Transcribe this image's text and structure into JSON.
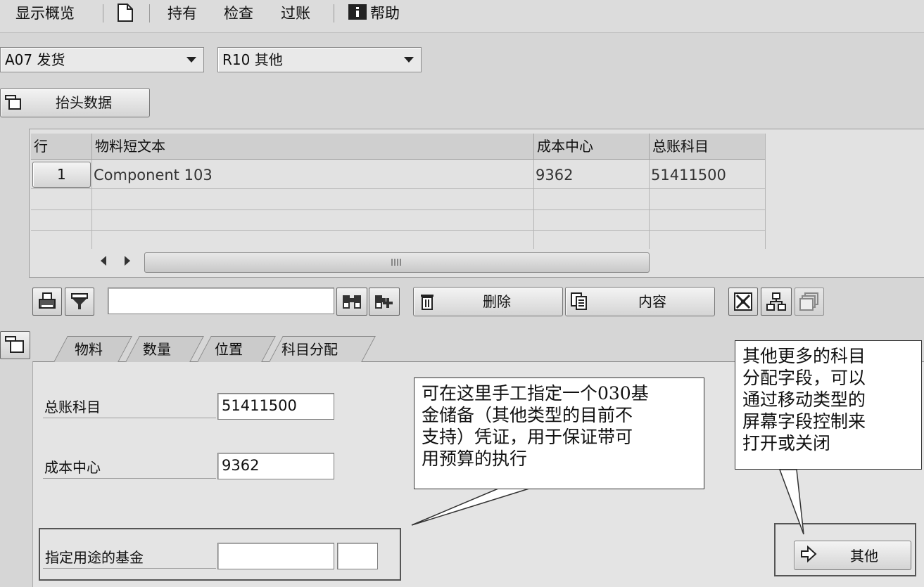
{
  "menubar": {
    "items": [
      "显示概览",
      "持有",
      "检查",
      "过账",
      "帮助"
    ]
  },
  "selectors": {
    "transaction": "A07 发货",
    "movement": "R10 其他"
  },
  "header_button": "抬头数据",
  "table": {
    "columns": [
      "行",
      "物料短文本",
      "成本中心",
      "总账科目"
    ],
    "rows": [
      {
        "line": "1",
        "material_text": "Component 103",
        "cost_center": "9362",
        "gl_account": "51411500"
      }
    ]
  },
  "toolbar": {
    "delete_label": "删除",
    "contents_label": "内容",
    "search_value": ""
  },
  "tabs": [
    "物料",
    "数量",
    "位置",
    "科目分配"
  ],
  "form": {
    "gl_account_label": "总账科目",
    "gl_account_value": "51411500",
    "cost_center_label": "成本中心",
    "cost_center_value": "9362",
    "earmarked_fund_label": "指定用途的基金",
    "earmarked_fund_value": "",
    "earmarked_fund_item": ""
  },
  "other_button": "其他",
  "callouts": {
    "fund_note": "可在这里手工指定一个030基\n金储备（其他类型的目前不\n支持）凭证，用于保证带可\n用预算的执行",
    "more_fields_note": "其他更多的科目\n分配字段，可以\n通过移动类型的\n屏幕字段控制来\n打开或关闭"
  }
}
